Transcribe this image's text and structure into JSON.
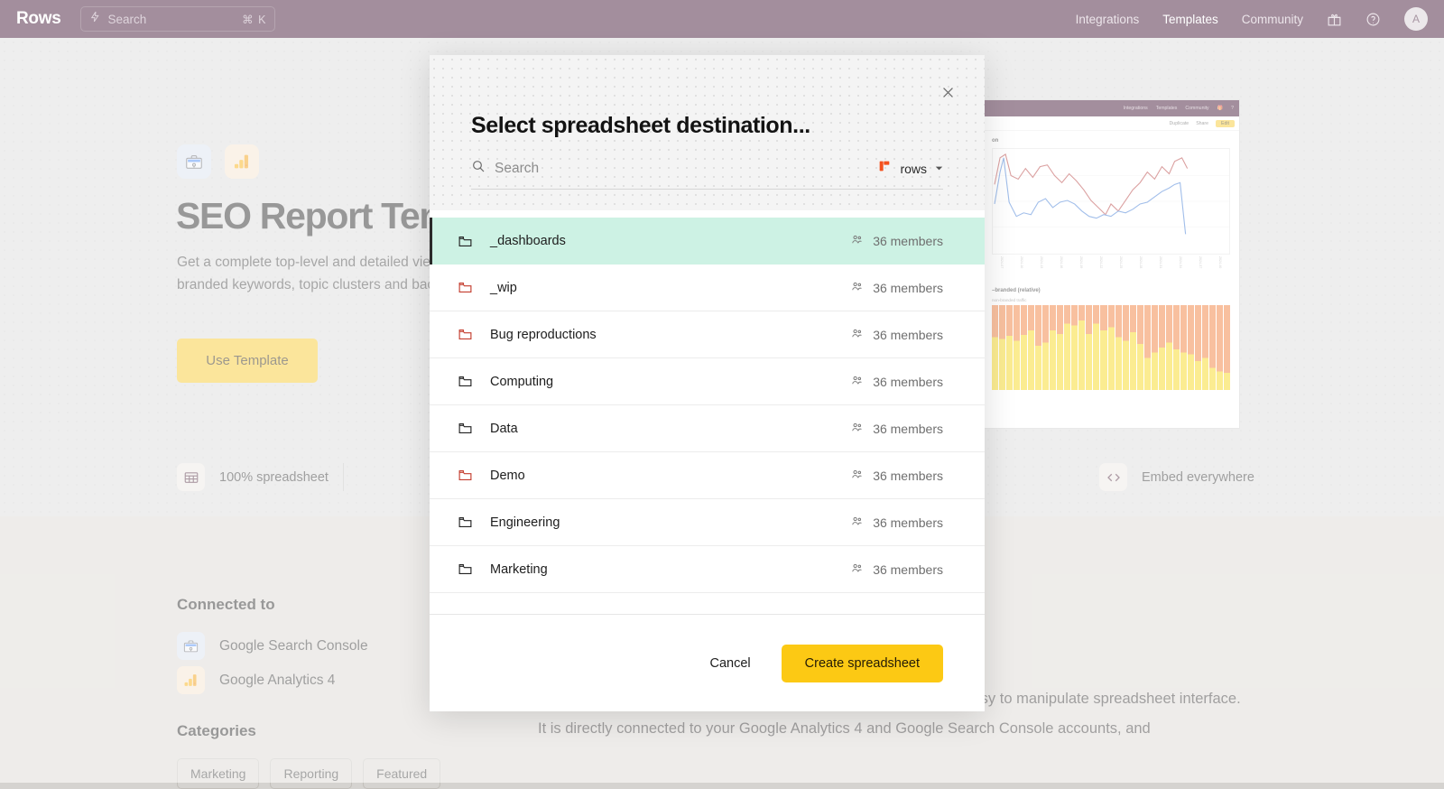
{
  "topbar": {
    "brand": "Rows",
    "search_placeholder": "Search",
    "search_shortcut": "⌘ K",
    "links": [
      {
        "label": "Integrations",
        "active": false
      },
      {
        "label": "Templates",
        "active": true
      },
      {
        "label": "Community",
        "active": false
      }
    ],
    "gift_icon": "gift-icon",
    "help_icon": "help-circle-icon",
    "avatar_initial": "A"
  },
  "hero": {
    "title": "SEO Report Template",
    "subtitle": "Get a complete top-level and detailed view of your SEO efforts, from branded vs non-branded keywords, topic clusters and backlinks.",
    "use_template_label": "Use Template",
    "app_tiles": [
      {
        "name": "google-search-console",
        "icon": "toolbox-icon"
      },
      {
        "name": "google-analytics-4",
        "icon": "bar-chart-icon"
      }
    ],
    "features": [
      {
        "icon": "spreadsheet-icon",
        "label": "100% spreadsheet"
      },
      {
        "icon": "code-brackets-icon",
        "label": "Embed everywhere"
      }
    ]
  },
  "preview": {
    "nav_links": [
      "Integrations",
      "Templates",
      "Community"
    ],
    "toolbar": [
      "Duplicate",
      "Share"
    ],
    "edit_label": "Edit",
    "chart_one_title": "on",
    "chart_two_title": "–branded (relative)",
    "chart_two_note": "non-branded traffic"
  },
  "connected": {
    "heading": "Connected to",
    "items": [
      {
        "label": "Google Search Console",
        "icon": "toolbox-icon"
      },
      {
        "label": "Google Analytics 4",
        "icon": "bar-chart-icon"
      }
    ]
  },
  "categories": {
    "heading": "Categories",
    "tags": [
      "Marketing",
      "Reporting",
      "Featured"
    ]
  },
  "body_copy": "that consolidates all your critical SEO metrics in one flexible and easy to manipulate spreadsheet interface. It is directly connected to your Google Analytics 4 and Google Search Console accounts, and",
  "modal": {
    "title": "Select spreadsheet destination...",
    "close_icon": "close-icon",
    "search_placeholder": "Search",
    "search_value": "",
    "search_icon": "search-icon",
    "workspace": {
      "name": "rows",
      "logo_icon": "rows-logo-icon",
      "chevron_icon": "chevron-down-icon",
      "logo_color": "#f4511e"
    },
    "folders": [
      {
        "name": "_dashboards",
        "members": "36 members",
        "selected": true,
        "icon_color": "#222222"
      },
      {
        "name": "_wip",
        "members": "36 members",
        "selected": false,
        "icon_color": "#c43d2e"
      },
      {
        "name": "Bug reproductions",
        "members": "36 members",
        "selected": false,
        "icon_color": "#c43d2e"
      },
      {
        "name": "Computing",
        "members": "36 members",
        "selected": false,
        "icon_color": "#222222"
      },
      {
        "name": "Data",
        "members": "36 members",
        "selected": false,
        "icon_color": "#222222"
      },
      {
        "name": "Demo",
        "members": "36 members",
        "selected": false,
        "icon_color": "#c43d2e"
      },
      {
        "name": "Engineering",
        "members": "36 members",
        "selected": false,
        "icon_color": "#222222"
      },
      {
        "name": "Marketing",
        "members": "36 members",
        "selected": false,
        "icon_color": "#222222"
      }
    ],
    "cancel_label": "Cancel",
    "create_label": "Create spreadsheet",
    "selected_highlight_color": "#cdf2e4",
    "primary_button_color": "#fcc914"
  }
}
